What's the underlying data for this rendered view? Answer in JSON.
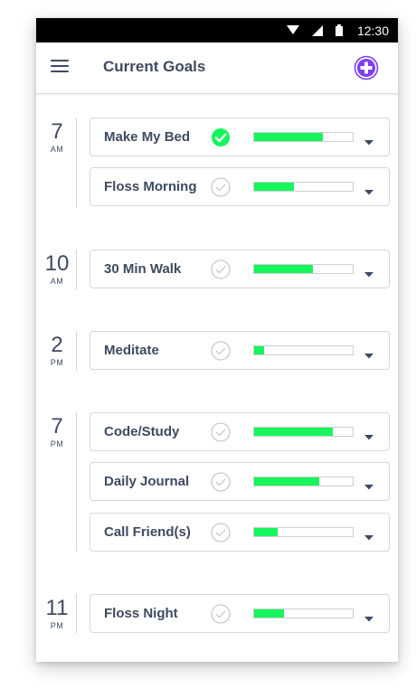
{
  "statusbar": {
    "time": "12:30",
    "icons": [
      "wifi-icon",
      "cell-signal-icon",
      "battery-icon"
    ]
  },
  "header": {
    "title": "Current Goals",
    "menu_icon": "hamburger-menu-icon",
    "add_icon": "plus-circle-icon"
  },
  "colors": {
    "accent": "#7b3ff2",
    "progress": "#15f55c",
    "text": "#3e4a60",
    "check_done": "#15f55c",
    "check_pending": "#c9c9c9"
  },
  "groups": [
    {
      "hour": "7",
      "ampm": "AM",
      "goals": [
        {
          "label": "Make My Bed",
          "done": true,
          "progress": 0.7
        },
        {
          "label": "Floss Morning",
          "done": false,
          "progress": 0.4
        }
      ]
    },
    {
      "hour": "10",
      "ampm": "AM",
      "goals": [
        {
          "label": "30 Min Walk",
          "done": false,
          "progress": 0.6
        }
      ]
    },
    {
      "hour": "2",
      "ampm": "PM",
      "goals": [
        {
          "label": "Meditate",
          "done": false,
          "progress": 0.1
        }
      ]
    },
    {
      "hour": "7",
      "ampm": "PM",
      "goals": [
        {
          "label": "Code/Study",
          "done": false,
          "progress": 0.8
        },
        {
          "label": "Daily Journal",
          "done": false,
          "progress": 0.66
        },
        {
          "label": "Call Friend(s)",
          "done": false,
          "progress": 0.24
        }
      ]
    },
    {
      "hour": "11",
      "ampm": "PM",
      "goals": [
        {
          "label": "Floss Night",
          "done": false,
          "progress": 0.3
        }
      ]
    }
  ]
}
